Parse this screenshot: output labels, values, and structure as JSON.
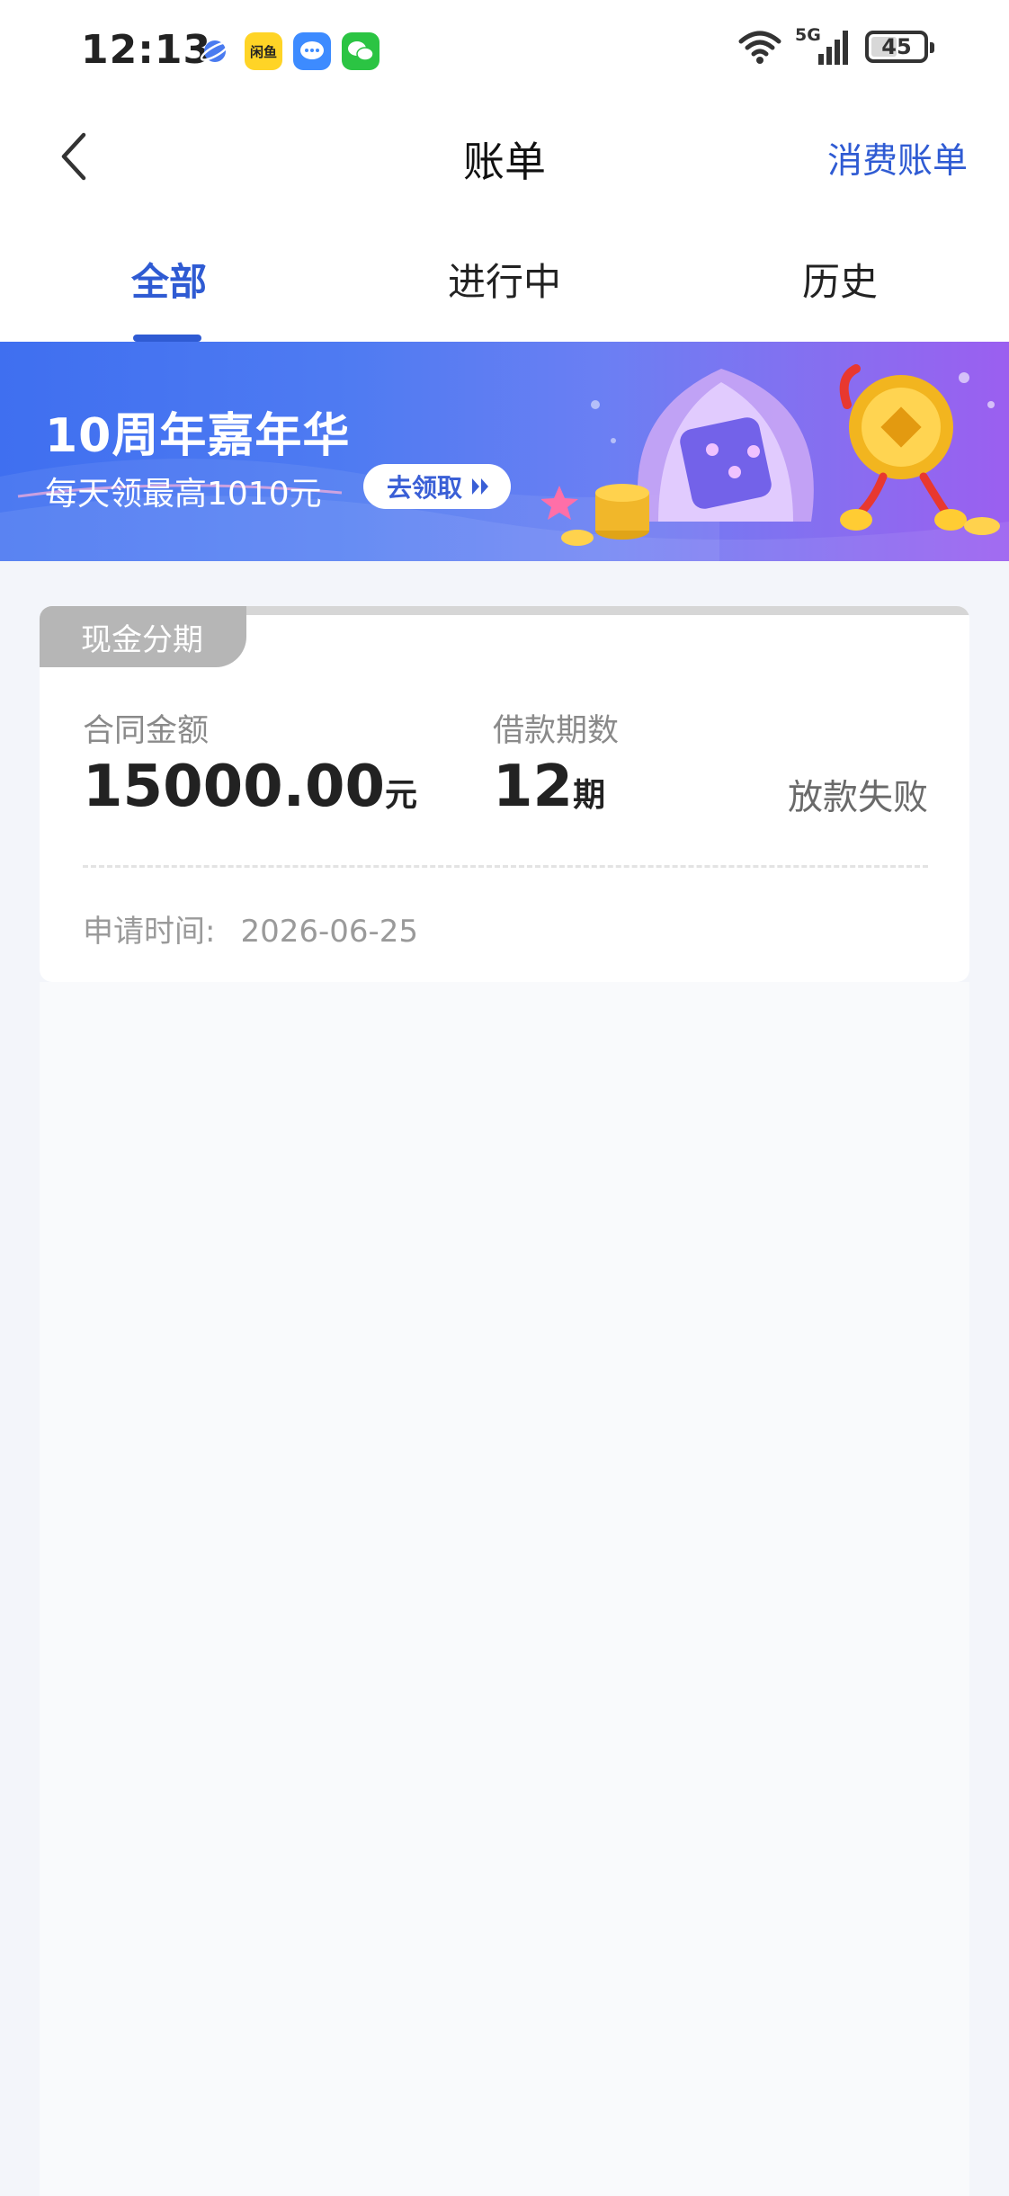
{
  "status_bar": {
    "time": "12:13",
    "network": "5G",
    "battery": "45",
    "app_icons": [
      "planet-app-icon",
      "xianyu-app-icon",
      "message-app-icon",
      "wechat-app-icon"
    ],
    "yellow_app_text": "闲鱼"
  },
  "nav": {
    "title": "账单",
    "right_link": "消费账单"
  },
  "tabs": [
    {
      "label": "全部",
      "active": true
    },
    {
      "label": "进行中",
      "active": false
    },
    {
      "label": "历史",
      "active": false
    }
  ],
  "banner": {
    "title": "10周年嘉年华",
    "subtitle": "每天领最高1010元",
    "button_label": "去领取"
  },
  "bill": {
    "product": "现金分期",
    "amount_label": "合同金额",
    "amount_value": "15000.00",
    "amount_unit": "元",
    "periods_label": "借款期数",
    "periods_value": "12",
    "periods_unit": "期",
    "status": "放款失败",
    "apply_label": "申请时间:",
    "apply_date": "2026-06-25"
  },
  "colors": {
    "accent": "#2f5bd3",
    "page_bg": "#f3f5fa",
    "tag_bg": "#b6b6b6"
  }
}
